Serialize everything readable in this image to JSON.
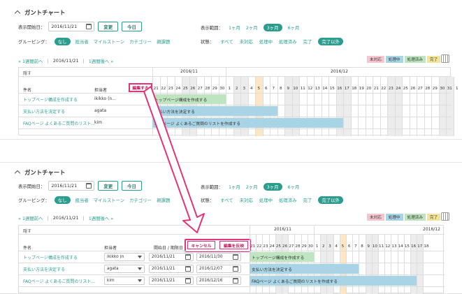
{
  "top": {
    "title": "ガントチャート",
    "start_label": "表示開始日：",
    "start_date": "2016/11/21",
    "change_btn": "変更",
    "today_btn": "今日",
    "range_label": "表示範囲：",
    "ranges": [
      "1ヶ月",
      "2ヶ月",
      "3ヶ月",
      "6ヶ月"
    ],
    "range_selected": "3ヶ月",
    "group_label": "グルーピング：",
    "group_selected": "なし",
    "groups": [
      "担当者",
      "マイルストーン",
      "カテゴリー",
      "親課題"
    ],
    "status_label": "状態：",
    "statuses": [
      "すべて",
      "未対応",
      "処理中",
      "処理済み",
      "完了"
    ],
    "status_selected": "完了以外",
    "nav_prev": "« 1週間前へ",
    "nav_date": "2016/11/21",
    "nav_next": "1週間後へ »",
    "legend": [
      "未対応",
      "処理中",
      "処理済み",
      "完了"
    ],
    "hide_label": "隠す",
    "month1": "2016/11",
    "month2": "2016/12",
    "col_name": "件名",
    "col_assignee": "担当者",
    "edit_btn": "編集する",
    "days": [
      "21",
      "22",
      "23",
      "24",
      "25",
      "26",
      "27",
      "28",
      "29",
      "30",
      "1",
      "2",
      "3",
      "4",
      "5",
      "6",
      "7",
      "8",
      "9",
      "10",
      "11",
      "12",
      "13",
      "14",
      "15",
      "16",
      "17",
      "18",
      "19",
      "20",
      "21",
      "22",
      "23",
      "24",
      "25",
      "26",
      "27",
      "28",
      "29",
      "30",
      "31",
      "1"
    ],
    "rows": [
      {
        "name": "トップページ構成を作成する",
        "assignee": "ikikko (n...",
        "bar": "トップページ構成を作成する"
      },
      {
        "name": "支払い方法を決定する",
        "assignee": "agata",
        "bar": "支払い方法を決定する"
      },
      {
        "name": "FAQページ よくあるご質問のリスト...",
        "assignee": "kim",
        "bar": "FAQページ よくあるご質問のリストを作成する"
      }
    ]
  },
  "bottom": {
    "title": "ガントチャート",
    "start_label": "表示開始日：",
    "start_date": "2016/11/21",
    "change_btn": "変更",
    "today_btn": "今日",
    "range_label": "表示範囲：",
    "ranges": [
      "1ヶ月",
      "2ヶ月",
      "3ヶ月",
      "6ヶ月"
    ],
    "range_selected": "3ヶ月",
    "group_label": "グルーピング：",
    "group_selected": "なし",
    "groups": [
      "担当者",
      "マイルストーン",
      "カテゴリー",
      "親課題"
    ],
    "status_label": "状態：",
    "statuses": [
      "すべて",
      "未対応",
      "処理中",
      "処理済み",
      "完了"
    ],
    "status_selected": "完了以外",
    "nav_prev": "« 1週間前へ",
    "nav_date": "2016/11/21",
    "nav_next": "1週間後へ »",
    "legend": [
      "未対応",
      "処理中",
      "処理済み",
      "完了"
    ],
    "hide_label": "隠す",
    "month1": "2016/11",
    "month2": "2016/12",
    "col_name": "件名",
    "col_assignee": "担当者",
    "col_dates": "開始日 / 期限日",
    "cancel_btn": "キャンセル",
    "save_btn": "編集を反映",
    "days": [
      "21",
      "22",
      "23",
      "24",
      "25",
      "26",
      "27",
      "28",
      "29",
      "30",
      "1",
      "2",
      "3",
      "4",
      "5",
      "6",
      "7",
      "8",
      "9",
      "10",
      "11",
      "12",
      "13",
      "14",
      "15",
      "16",
      "17",
      "18"
    ],
    "rows": [
      {
        "name": "トップページ構成を作成する",
        "assignee": "ikikko (n",
        "start": "2016/11/21",
        "due": "2016/11/30",
        "bar": "トップページ構成を作成する"
      },
      {
        "name": "支払い方法を決定する",
        "assignee": "agata",
        "start": "2016/11/21",
        "due": "2016/12/07",
        "bar": "支払い方法を決定する"
      },
      {
        "name": "FAQページ よくあるご質問のリスト...",
        "assignee": "kim",
        "start": "2016/11/21",
        "due": "2016/12/16",
        "bar": "FAQページ よくあるご質問のリストを作成する"
      }
    ]
  },
  "colors": {
    "accent": "#2a9d8f",
    "highlight": "#e0357a",
    "open": "#f6c6cf",
    "inprogress": "#a9d4e6",
    "resolved": "#bfe5c0",
    "closed": "#f2e59a"
  }
}
